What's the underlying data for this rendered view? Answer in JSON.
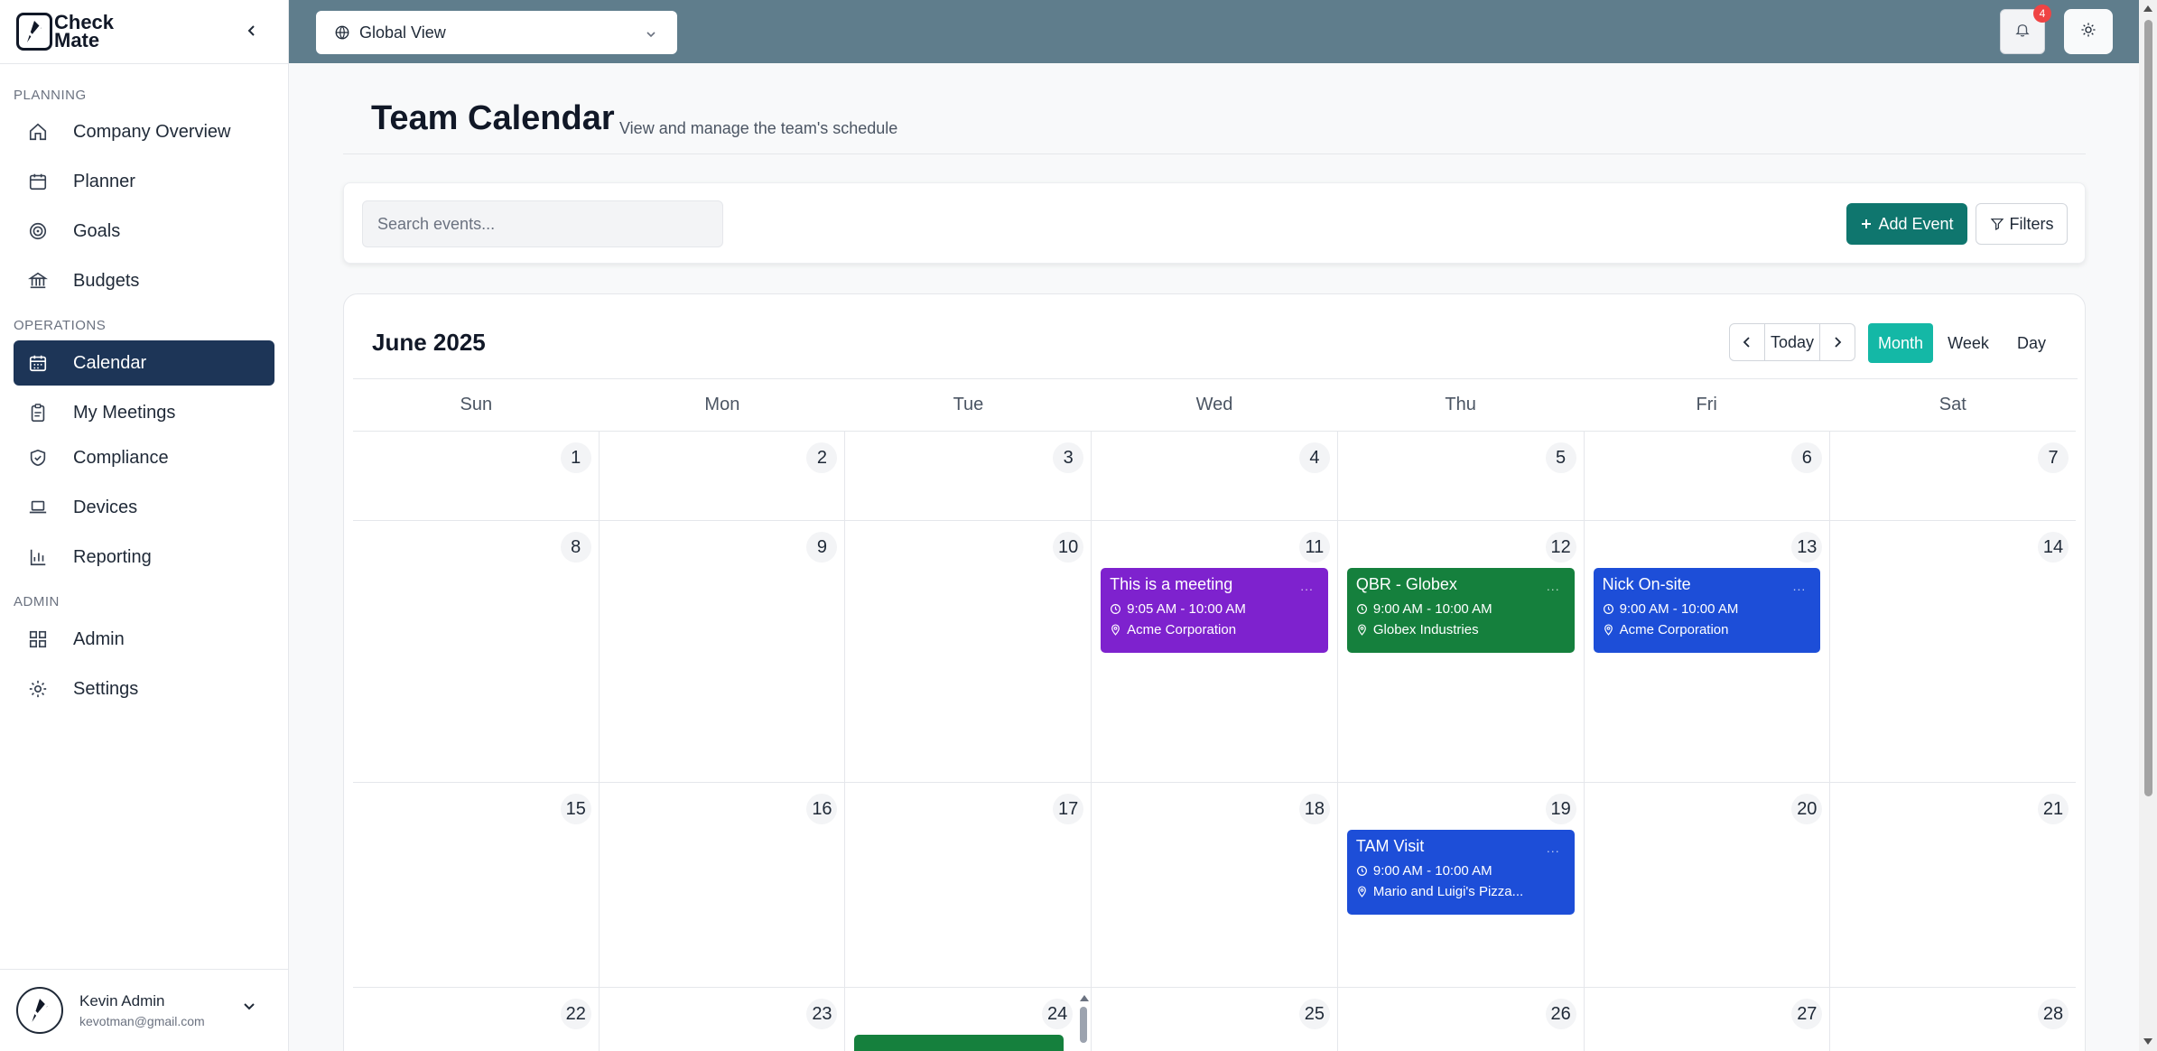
{
  "app": {
    "logo_text": "Check Mate"
  },
  "sidebar": {
    "sections": [
      {
        "label": "PLANNING"
      },
      {
        "label": "OPERATIONS"
      },
      {
        "label": "ADMIN"
      }
    ],
    "items": [
      {
        "label": "Company Overview",
        "icon": "home-icon"
      },
      {
        "label": "Planner",
        "icon": "calendar-icon"
      },
      {
        "label": "Goals",
        "icon": "target-icon"
      },
      {
        "label": "Budgets",
        "icon": "bank-icon"
      },
      {
        "label": "Calendar",
        "icon": "calendar-grid-icon",
        "active": true
      },
      {
        "label": "My Meetings",
        "icon": "clipboard-icon"
      },
      {
        "label": "Compliance",
        "icon": "shield-check-icon"
      },
      {
        "label": "Devices",
        "icon": "laptop-icon"
      },
      {
        "label": "Reporting",
        "icon": "bar-chart-icon"
      },
      {
        "label": "Admin",
        "icon": "grid-icon"
      },
      {
        "label": "Settings",
        "icon": "gear-icon"
      }
    ],
    "user": {
      "name": "Kevin Admin",
      "email": "kevotman@gmail.com"
    }
  },
  "topbar": {
    "view_select": "Global View",
    "notification_count": "4"
  },
  "page": {
    "title": "Team Calendar",
    "subtitle": "View and manage the team's schedule"
  },
  "toolbar": {
    "search_placeholder": "Search events...",
    "add_label": "Add Event",
    "filters_label": "Filters"
  },
  "calendar": {
    "month_label": "June 2025",
    "today_label": "Today",
    "views": [
      "Month",
      "Week",
      "Day"
    ],
    "active_view": "Month",
    "weekdays": [
      "Sun",
      "Mon",
      "Tue",
      "Wed",
      "Thu",
      "Fri",
      "Sat"
    ],
    "weeks": [
      [
        "1",
        "2",
        "3",
        "4",
        "5",
        "6",
        "7"
      ],
      [
        "8",
        "9",
        "10",
        "11",
        "12",
        "13",
        "14"
      ],
      [
        "15",
        "16",
        "17",
        "18",
        "19",
        "20",
        "21"
      ],
      [
        "22",
        "23",
        "24",
        "25",
        "26",
        "27",
        "28"
      ]
    ],
    "events": [
      {
        "title": "This is a meeting",
        "time": "9:05 AM - 10:00 AM",
        "location": "Acme Corporation",
        "color": "#7e22ce",
        "week": 1,
        "day": 3
      },
      {
        "title": "QBR - Globex",
        "time": "9:00 AM - 10:00 AM",
        "location": "Globex Industries",
        "color": "#15803d",
        "week": 1,
        "day": 4
      },
      {
        "title": "Nick On-site",
        "time": "9:00 AM - 10:00 AM",
        "location": "Acme Corporation",
        "color": "#1d4ed8",
        "week": 1,
        "day": 5
      },
      {
        "title": "TAM Visit",
        "time": "9:00 AM - 10:00 AM",
        "location": "Mario and Luigi's Pizza...",
        "color": "#1d4ed8",
        "week": 2,
        "day": 4
      }
    ],
    "more_glyph": "..."
  },
  "colors": {
    "sidebar_active": "#1d3557",
    "topbar": "#5f7d8c",
    "primary_button": "#0f766e",
    "view_active": "#14b8a6"
  }
}
